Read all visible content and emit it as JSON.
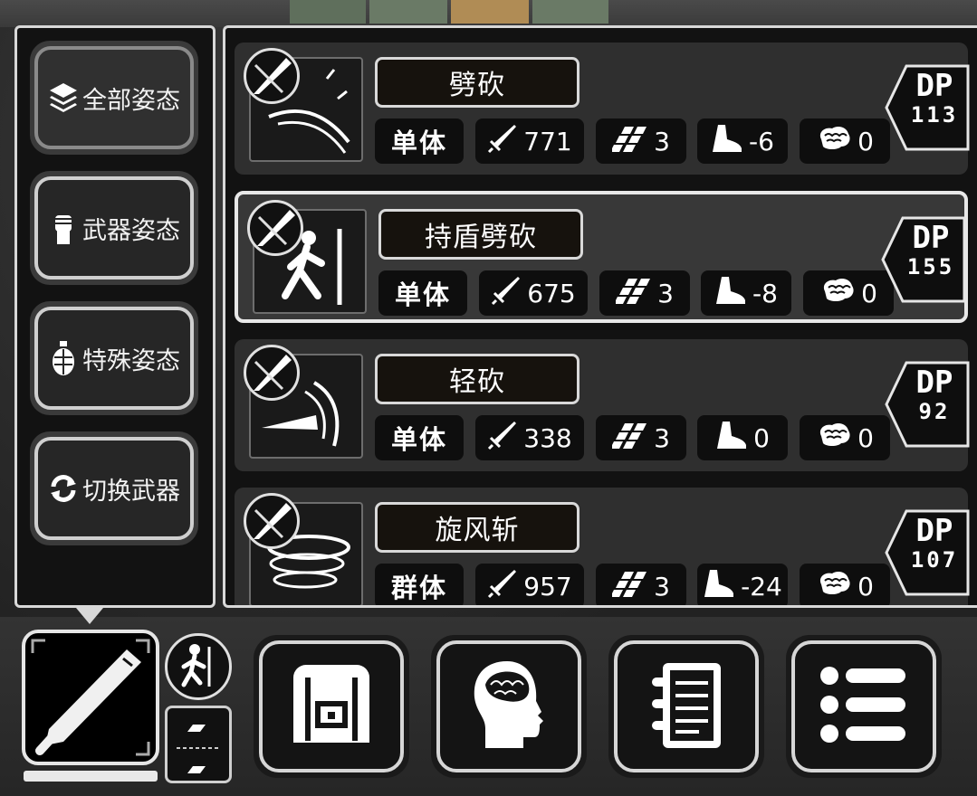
{
  "stance_menu": {
    "items": [
      {
        "label": "全部姿态",
        "icon": "layers-icon",
        "active": true
      },
      {
        "label": "武器姿态",
        "icon": "fist-icon",
        "active": false
      },
      {
        "label": "特殊姿态",
        "icon": "grenade-icon",
        "active": false
      },
      {
        "label": "切换武器",
        "icon": "swap-icon",
        "active": false
      }
    ]
  },
  "skills": [
    {
      "name": "劈砍",
      "target": "单体",
      "attack": "771",
      "hit": "3",
      "speed": "-6",
      "mind": "0",
      "dp_label": "DP",
      "dp": "113",
      "selected": false
    },
    {
      "name": "持盾劈砍",
      "target": "单体",
      "attack": "675",
      "hit": "3",
      "speed": "-8",
      "mind": "0",
      "dp_label": "DP",
      "dp": "155",
      "selected": true
    },
    {
      "name": "轻砍",
      "target": "单体",
      "attack": "338",
      "hit": "3",
      "speed": "0",
      "mind": "0",
      "dp_label": "DP",
      "dp": "92",
      "selected": false
    },
    {
      "name": "旋风斩",
      "target": "群体",
      "attack": "957",
      "hit": "3",
      "speed": "-24",
      "mind": "0",
      "dp_label": "DP",
      "dp": "107",
      "selected": false
    }
  ],
  "bottom_bar": {
    "weapon_icon": "machete-icon",
    "pose_icon": "walking-man-icon",
    "buttons": [
      {
        "name": "inventory-button",
        "icon": "backpack-icon"
      },
      {
        "name": "skills-button",
        "icon": "brain-head-icon"
      },
      {
        "name": "journal-button",
        "icon": "notebook-icon"
      },
      {
        "name": "menu-button",
        "icon": "list-icon"
      }
    ]
  },
  "colors": {
    "panel_border": "#d8d8d8",
    "panel_bg": "#121212",
    "card_bg": "#2f2f2f"
  }
}
